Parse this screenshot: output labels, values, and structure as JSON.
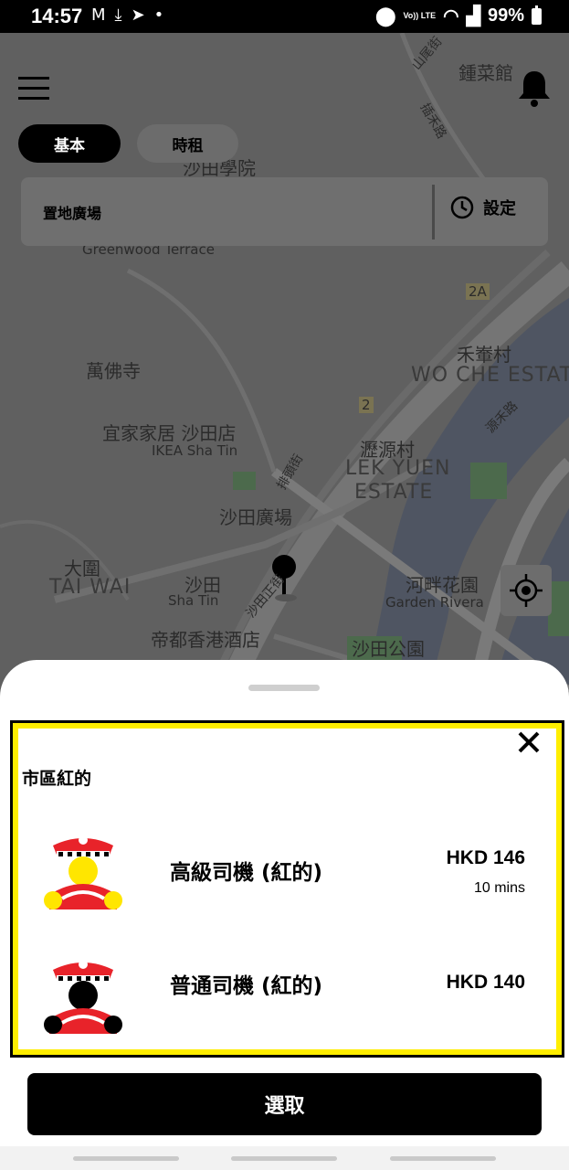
{
  "status": {
    "time": "14:57",
    "battery": "99%",
    "network": "Vo)) LTE"
  },
  "header": {
    "menu_icon": "hamburger-menu-icon",
    "bell_icon": "bell-icon"
  },
  "tabs": [
    {
      "label": "基本",
      "active": true
    },
    {
      "label": "時租",
      "active": false
    }
  ],
  "search": {
    "place": "置地廣場",
    "set_label": "設定",
    "set_icon": "clock-icon"
  },
  "map": {
    "labels": [
      {
        "text": "鍾菜館"
      },
      {
        "text": "沙田學院"
      },
      {
        "text": "Greenwood Terrace"
      },
      {
        "text": "2A"
      },
      {
        "text": "禾輋村"
      },
      {
        "text": "WO CHE ESTATE"
      },
      {
        "text": "萬佛寺"
      },
      {
        "text": "2"
      },
      {
        "text": "宜家家居 沙田店"
      },
      {
        "text": "IKEA Sha Tin"
      },
      {
        "text": "瀝源村"
      },
      {
        "text": "LEK YUEN"
      },
      {
        "text": "ESTATE"
      },
      {
        "text": "沙田廣場"
      },
      {
        "text": "大圍"
      },
      {
        "text": "TAI WAI"
      },
      {
        "text": "沙田"
      },
      {
        "text": "Sha Tin"
      },
      {
        "text": "河畔花園"
      },
      {
        "text": "Garden Rivera"
      },
      {
        "text": "帝都香港酒店"
      },
      {
        "text": "沙田公園"
      },
      {
        "text": "排頭街"
      },
      {
        "text": "沙田正街"
      },
      {
        "text": "源禾路"
      },
      {
        "text": "山尾街"
      },
      {
        "text": "插禾路"
      }
    ]
  },
  "sheet": {
    "category": "市區紅的",
    "options": [
      {
        "name": "高級司機 (紅的)",
        "price": "HKD 146",
        "eta": "10 mins",
        "icon": "premium-driver-icon"
      },
      {
        "name": "普通司機 (紅的)",
        "price": "HKD 140",
        "eta": "",
        "icon": "standard-driver-icon"
      }
    ],
    "select_label": "選取"
  },
  "colors": {
    "highlight": "#ffee00",
    "taxi_red": "#e8232a",
    "premium_face": "#ffe600"
  }
}
